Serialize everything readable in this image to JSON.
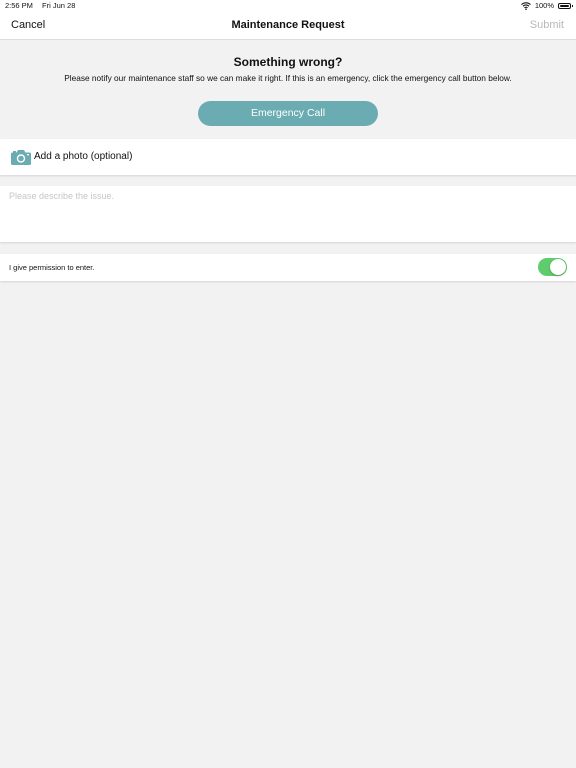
{
  "status_bar": {
    "time": "2:56 PM",
    "date": "Fri Jun 28",
    "battery": "100%"
  },
  "nav": {
    "cancel_label": "Cancel",
    "title": "Maintenance Request",
    "submit_label": "Submit"
  },
  "intro": {
    "heading": "Something wrong?",
    "message": "Please notify our maintenance staff so we can make it right. If this is an emergency, click the emergency call button below.",
    "emergency_label": "Emergency Call"
  },
  "photo": {
    "label": "Add a photo (optional)",
    "icon": "camera-icon"
  },
  "description": {
    "value": "",
    "placeholder": "Please describe the issue."
  },
  "permission": {
    "label": "I give permission to enter.",
    "enabled": true
  },
  "colors": {
    "accent": "#6aacb2",
    "toggle_on": "#5fcc6d",
    "background": "#f2f2f2",
    "disabled_text": "#b9b9b9"
  }
}
